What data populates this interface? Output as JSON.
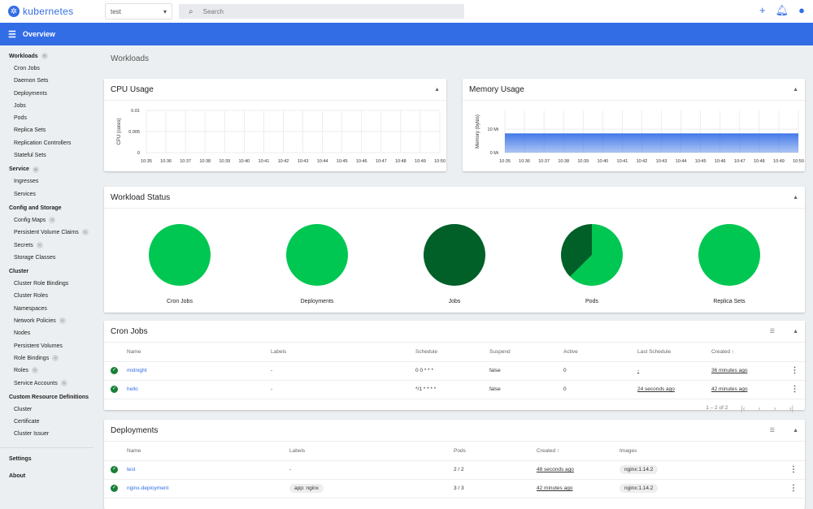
{
  "header": {
    "logo": "kubernetes",
    "namespace": "test",
    "search_placeholder": "Search",
    "icons": [
      "plus-icon",
      "bell-icon",
      "account-icon"
    ]
  },
  "toolbar": {
    "title": "Overview"
  },
  "sidebar": {
    "sections": [
      {
        "label": "Workloads",
        "badge": "N",
        "items": [
          {
            "label": "Cron Jobs"
          },
          {
            "label": "Daemon Sets"
          },
          {
            "label": "Deployments"
          },
          {
            "label": "Jobs"
          },
          {
            "label": "Pods"
          },
          {
            "label": "Replica Sets"
          },
          {
            "label": "Replication Controllers"
          },
          {
            "label": "Stateful Sets"
          }
        ]
      },
      {
        "label": "Service",
        "badge": "N",
        "items": [
          {
            "label": "Ingresses"
          },
          {
            "label": "Services"
          }
        ]
      },
      {
        "label": "Config and Storage",
        "items": [
          {
            "label": "Config Maps",
            "badge": "N"
          },
          {
            "label": "Persistent Volume Claims",
            "badge": "N"
          },
          {
            "label": "Secrets",
            "badge": "N"
          },
          {
            "label": "Storage Classes"
          }
        ]
      },
      {
        "label": "Cluster",
        "items": [
          {
            "label": "Cluster Role Bindings"
          },
          {
            "label": "Cluster Roles"
          },
          {
            "label": "Namespaces"
          },
          {
            "label": "Network Policies",
            "badge": "N"
          },
          {
            "label": "Nodes"
          },
          {
            "label": "Persistent Volumes"
          },
          {
            "label": "Role Bindings",
            "badge": "N"
          },
          {
            "label": "Roles",
            "badge": "N"
          },
          {
            "label": "Service Accounts",
            "badge": "N"
          }
        ]
      },
      {
        "label": "Custom Resource Definitions",
        "items": [
          {
            "label": "Cluster"
          },
          {
            "label": "Certificate"
          },
          {
            "label": "Cluster Issuer"
          }
        ]
      }
    ],
    "footer": [
      {
        "label": "Settings"
      },
      {
        "label": "About"
      }
    ]
  },
  "main": {
    "title": "Workloads",
    "cpu_title": "CPU Usage",
    "mem_title": "Memory Usage",
    "status_title": "Workload Status"
  },
  "chart_data": [
    {
      "type": "line",
      "title": "CPU Usage",
      "ylabel": "CPU (cores)",
      "yticks": [
        "0",
        "0.005",
        "0.01"
      ],
      "ylim": [
        0,
        0.01
      ],
      "x": [
        "10:35",
        "10:36",
        "10:37",
        "10:38",
        "10:39",
        "10:40",
        "10:41",
        "10:42",
        "10:43",
        "10:44",
        "10:45",
        "10:46",
        "10:47",
        "10:48",
        "10:49",
        "10:50"
      ],
      "values": [],
      "grid": true
    },
    {
      "type": "area",
      "title": "Memory Usage",
      "ylabel": "Memory (bytes)",
      "yticks": [
        "0 Mi",
        "10 Mi"
      ],
      "ylim": [
        0,
        18
      ],
      "x": [
        "10:35",
        "10:36",
        "10:37",
        "10:38",
        "10:39",
        "10:40",
        "10:41",
        "10:42",
        "10:43",
        "10:44",
        "10:45",
        "10:46",
        "10:47",
        "10:48",
        "10:49",
        "10:50"
      ],
      "values": [
        8,
        8,
        8,
        8,
        8,
        8,
        8,
        8,
        8,
        8,
        8,
        8,
        8,
        8,
        8,
        8
      ],
      "color": "#326de6",
      "grid": true
    },
    {
      "type": "pie",
      "title": "Workload Status",
      "charts": [
        {
          "label": "Cron Jobs",
          "values": [
            1,
            0
          ]
        },
        {
          "label": "Deployments",
          "values": [
            1,
            0
          ]
        },
        {
          "label": "Jobs",
          "values": [
            0,
            1
          ]
        },
        {
          "label": "Pods",
          "values": [
            5,
            3
          ]
        },
        {
          "label": "Replica Sets",
          "values": [
            1,
            0
          ]
        }
      ],
      "colors": [
        "#00c752",
        "#006028"
      ]
    }
  ],
  "cronjobs": {
    "title": "Cron Jobs",
    "columns": [
      "Name",
      "Labels",
      "Schedule",
      "Suspend",
      "Active",
      "Last Schedule",
      "Created"
    ],
    "sort_icon": "↑",
    "rows": [
      {
        "name": "midnight",
        "labels": "-",
        "schedule": "0 0 * * *",
        "suspend": "false",
        "active": "0",
        "last": "-",
        "created": "36 minutes ago"
      },
      {
        "name": "hello",
        "labels": "-",
        "schedule": "*/1 * * * *",
        "suspend": "false",
        "active": "0",
        "last": "24 seconds ago",
        "created": "42 minutes ago"
      }
    ],
    "pagination": "1 – 2 of 2"
  },
  "deployments": {
    "title": "Deployments",
    "columns": [
      "Name",
      "Labels",
      "Pods",
      "Created",
      "Images"
    ],
    "sort_icon": "↑",
    "rows": [
      {
        "name": "test",
        "labels": "-",
        "pods": "2 / 2",
        "created": "48 seconds ago",
        "image": "nginx:1.14.2"
      },
      {
        "name": "nginx-deployment",
        "labels": "app: nginx",
        "pods": "3 / 3",
        "created": "42 minutes ago",
        "image": "nginx:1.14.2"
      }
    ]
  }
}
